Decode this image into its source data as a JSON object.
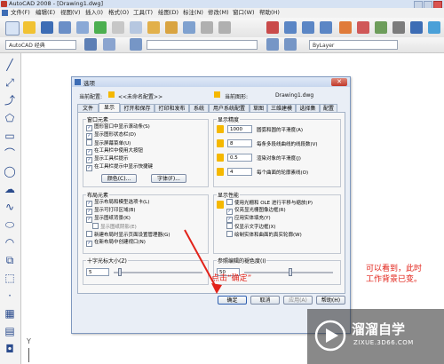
{
  "app": {
    "title": "AutoCAD 2008 - [Drawing1.dwg]"
  },
  "menu": [
    "文件(F)",
    "编辑(E)",
    "视图(V)",
    "插入(I)",
    "格式(O)",
    "工具(T)",
    "绘图(D)",
    "标注(N)",
    "修改(M)",
    "窗口(W)",
    "帮助(H)"
  ],
  "toolbar2": {
    "workspace": "AutoCAD 经典",
    "layer": "ByLayer"
  },
  "dialog": {
    "title": "选项",
    "current_profile_label": "当前配置:",
    "current_profile_value": "<<未命名配置>>",
    "current_drawing_label": "当前图形:",
    "current_drawing_value": "Drawing1.dwg",
    "tabs": [
      "文件",
      "显示",
      "打开和保存",
      "打印和发布",
      "系统",
      "用户系统配置",
      "草图",
      "三维建模",
      "选择集",
      "配置"
    ],
    "window_elements": {
      "title": "窗口元素",
      "items": [
        "图形窗口中显示滚动条(S)",
        "显示图形状态栏(D)",
        "显示屏幕菜单(U)",
        "在工具栏中使用大按钮",
        "显示工具栏提示",
        "在工具栏提示中显示快捷键"
      ],
      "checked": [
        true,
        true,
        false,
        true,
        true,
        true
      ],
      "colors_btn": "颜色(C)...",
      "fonts_btn": "字体(F)..."
    },
    "layout_elements": {
      "title": "布局元素",
      "items": [
        "显示布局和模型选项卡(L)",
        "显示可打印区域(B)",
        "显示图纸背景(K)",
        "显示图纸阴影(E)",
        "新建布局时显示页面设置管理器(G)",
        "在新布局中创建视口(N)"
      ],
      "checked": [
        true,
        true,
        true,
        false,
        false,
        true
      ]
    },
    "crosshair": {
      "title": "十字光标大小(Z)",
      "value": "5",
      "level_percent": 5
    },
    "display_precision": {
      "title": "显示精度",
      "items": [
        {
          "value": "1000",
          "label": "圆弧和圆的平滑度(A)"
        },
        {
          "value": "8",
          "label": "每条多段线曲线的线段数(V)"
        },
        {
          "value": "0.5",
          "label": "渲染对象的平滑度(J)"
        },
        {
          "value": "4",
          "label": "每个曲面的轮廓素线(O)"
        }
      ]
    },
    "display_performance": {
      "title": "显示性能",
      "items": [
        "使用光栅和 OLE 进行平移与缩放(P)",
        "仅亮显光栅图像边框(R)",
        "应用实体填充(Y)",
        "仅显示文字边框(X)",
        "绘制实体和曲面的真实轮廓(W)"
      ],
      "checked": [
        false,
        true,
        true,
        false,
        false
      ]
    },
    "fade": {
      "title": "参照编辑的褪色度(I)",
      "value": "50",
      "level_percent": 50
    },
    "buttons": {
      "ok": "确定",
      "cancel": "取消",
      "apply": "应用(A)",
      "help": "帮助(H)"
    }
  },
  "annotations": {
    "click_ok": "点击“确定”",
    "note_line1": "可以看到，此时",
    "note_line2": "工作背景已变。"
  },
  "watermark": {
    "brand": "溜溜自学",
    "url": "ZIXUE.3D66.COM"
  },
  "colors": {
    "annotation": "#e2231a",
    "icon_yellow": "#f5b800",
    "dialog_bg": "#e9eef6"
  }
}
